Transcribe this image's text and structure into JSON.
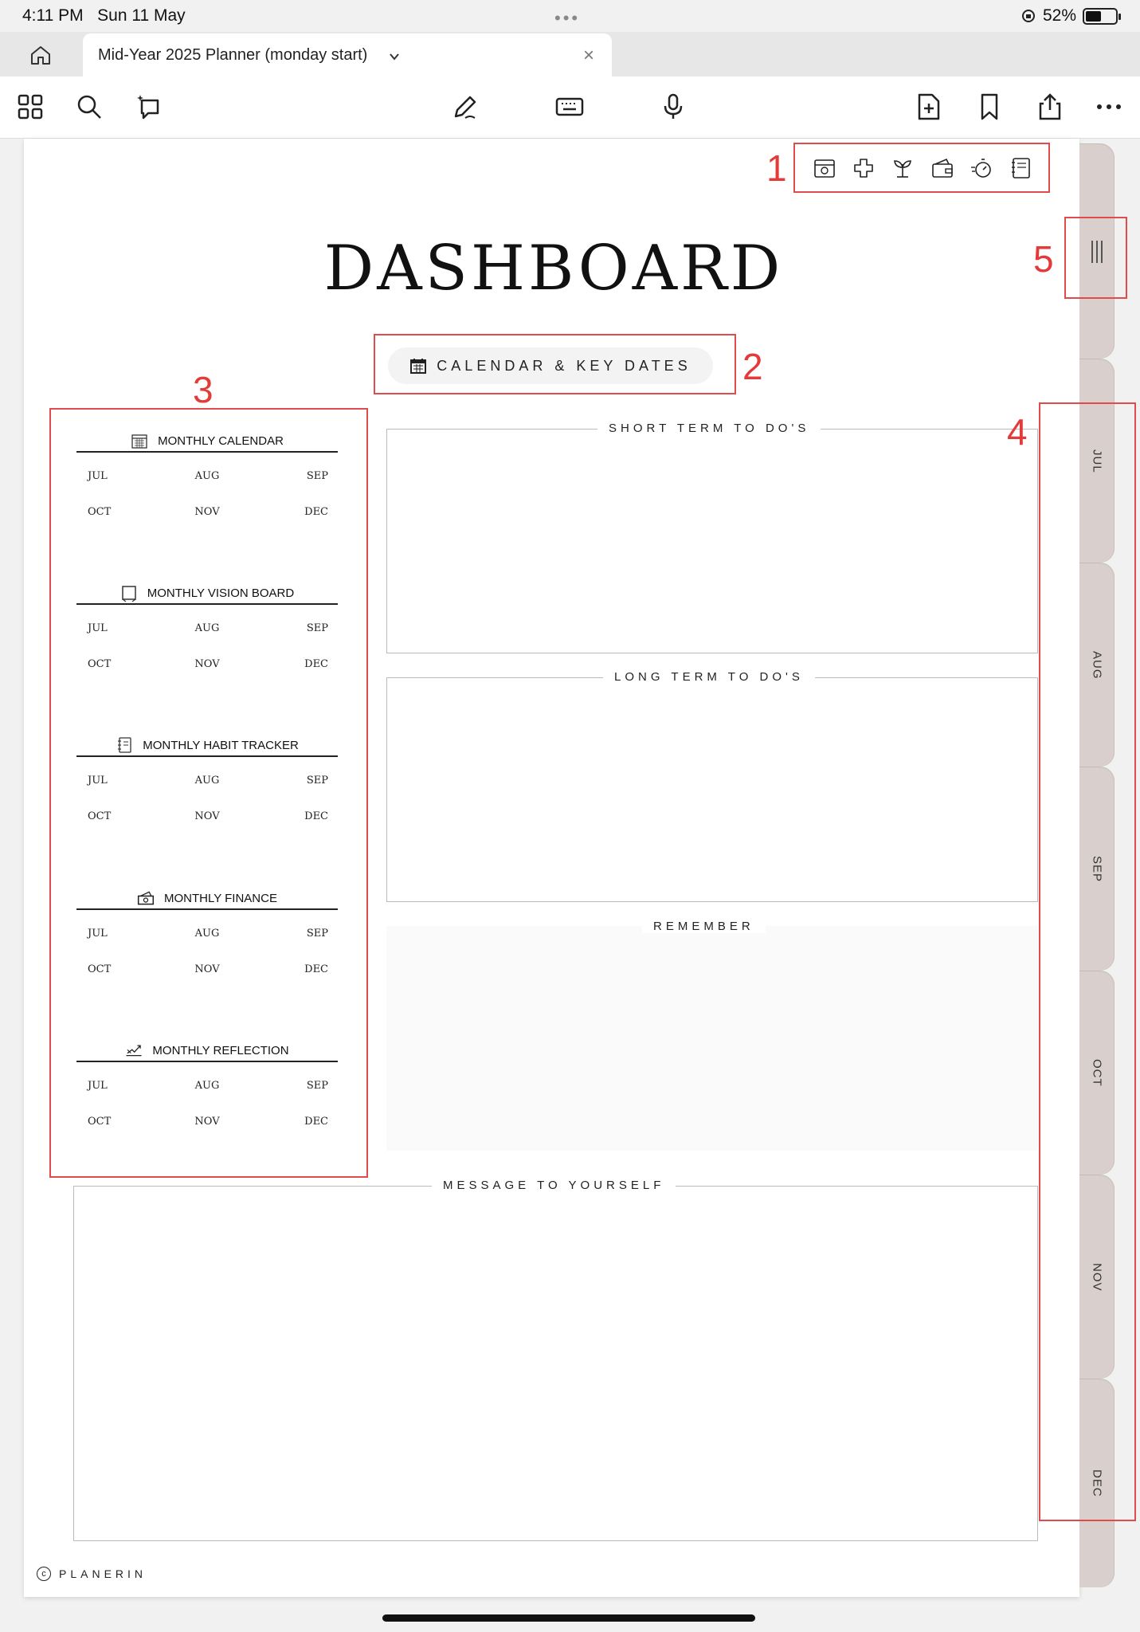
{
  "status": {
    "time": "4:11 PM",
    "date": "Sun 11 May",
    "battery": "52%",
    "battery_level": 0.52
  },
  "tab": {
    "title": "Mid-Year 2025 Planner (monday start)"
  },
  "page": {
    "title": "DASHBOARD",
    "calendar_button": "CALENDAR & KEY DATES",
    "sections": [
      {
        "title": "MONTHLY CALENDAR",
        "icon": "calendar-icon"
      },
      {
        "title": "MONTHLY VISION BOARD",
        "icon": "frame-icon"
      },
      {
        "title": "MONTHLY HABIT TRACKER",
        "icon": "notebook-icon"
      },
      {
        "title": "MONTHLY FINANCE",
        "icon": "money-icon"
      },
      {
        "title": "MONTHLY REFLECTION",
        "icon": "reflection-icon"
      }
    ],
    "months": [
      "JUL",
      "AUG",
      "SEP",
      "OCT",
      "NOV",
      "DEC"
    ],
    "short_term": "SHORT TERM TO DO'S",
    "long_term": "LONG TERM TO DO'S",
    "remember": "REMEMBER",
    "message": "MESSAGE TO YOURSELF",
    "brand": "PLANERIN",
    "copyright_symbol": "c"
  },
  "quick_icons": [
    "calendar-icon",
    "health-icon",
    "plant-icon",
    "wallet-icon",
    "stopwatch-icon",
    "journal-icon"
  ],
  "side_tabs": [
    "JUL",
    "AUG",
    "SEP",
    "OCT",
    "NOV",
    "DEC"
  ],
  "annotations": [
    "1",
    "2",
    "3",
    "4",
    "5"
  ],
  "colors": {
    "annotation": "#e04b4b",
    "side_tab": "#d9cfcc"
  }
}
